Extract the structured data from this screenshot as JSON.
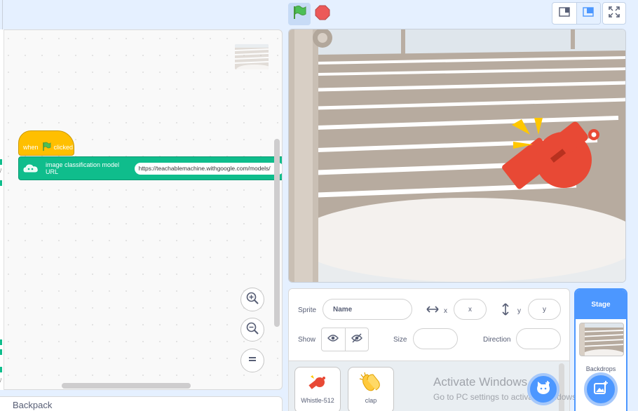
{
  "code": {
    "hat_when": "when",
    "hat_clicked": "clicked",
    "ml_label": "image classification model URL",
    "ml_url": "https://teachablemachine.withgoogle.com/models/"
  },
  "backpack": {
    "label": "Backpack"
  },
  "sprite_info": {
    "sprite_label": "Sprite",
    "name_placeholder": "Name",
    "x_label": "x",
    "x_placeholder": "x",
    "y_label": "y",
    "y_placeholder": "y",
    "show_label": "Show",
    "size_label": "Size",
    "direction_label": "Direction"
  },
  "sprites": [
    {
      "name": "Whistle-512"
    },
    {
      "name": "clap"
    }
  ],
  "stage_selector": {
    "header": "Stage",
    "backdrops_label": "Backdrops"
  },
  "watermark": {
    "title": "Activate Windows",
    "subtitle": "Go to PC settings to activate Windows."
  },
  "icons": {
    "green_flag": "green-flag-icon",
    "stop": "stop-icon",
    "zoom_in": "zoom-in-icon",
    "zoom_out": "zoom-out-icon",
    "zoom_reset": "zoom-reset-icon",
    "visible": "eye-icon",
    "hidden": "eye-slash-icon"
  },
  "colors": {
    "events_block": "#ffbf00",
    "extension_block": "#0fbd8c",
    "accent": "#4c97ff",
    "stop": "#ec5959"
  }
}
